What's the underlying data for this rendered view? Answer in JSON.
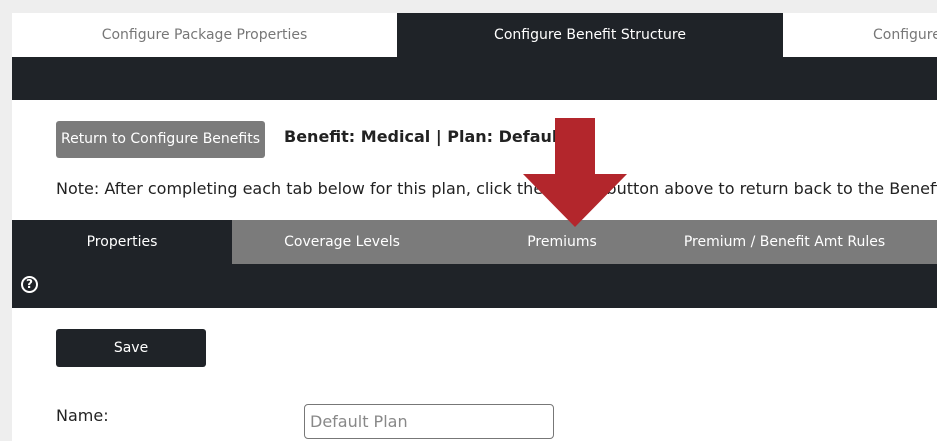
{
  "wizard": {
    "tabs": [
      {
        "label": "Configure Package Properties"
      },
      {
        "label": "Configure Benefit Structure"
      },
      {
        "label": "Configure"
      }
    ]
  },
  "header": {
    "return_label": "Return to Configure Benefits",
    "benefit_title": "Benefit: Medical | Plan: Default",
    "note": "Note: After completing each tab below for this plan, click the Return button above to return back to the Benefit"
  },
  "sub_tabs": [
    {
      "label": "Properties"
    },
    {
      "label": "Coverage Levels"
    },
    {
      "label": "Premiums"
    },
    {
      "label": "Premium / Benefit Amt Rules"
    }
  ],
  "help_icon": "?",
  "form": {
    "save_label": "Save",
    "name_label": "Name:",
    "name_placeholder": "Default Plan",
    "name_value": ""
  },
  "colors": {
    "dark": "#1f2328",
    "gray": "#7b7b7b",
    "arrow": "#b3262c"
  }
}
